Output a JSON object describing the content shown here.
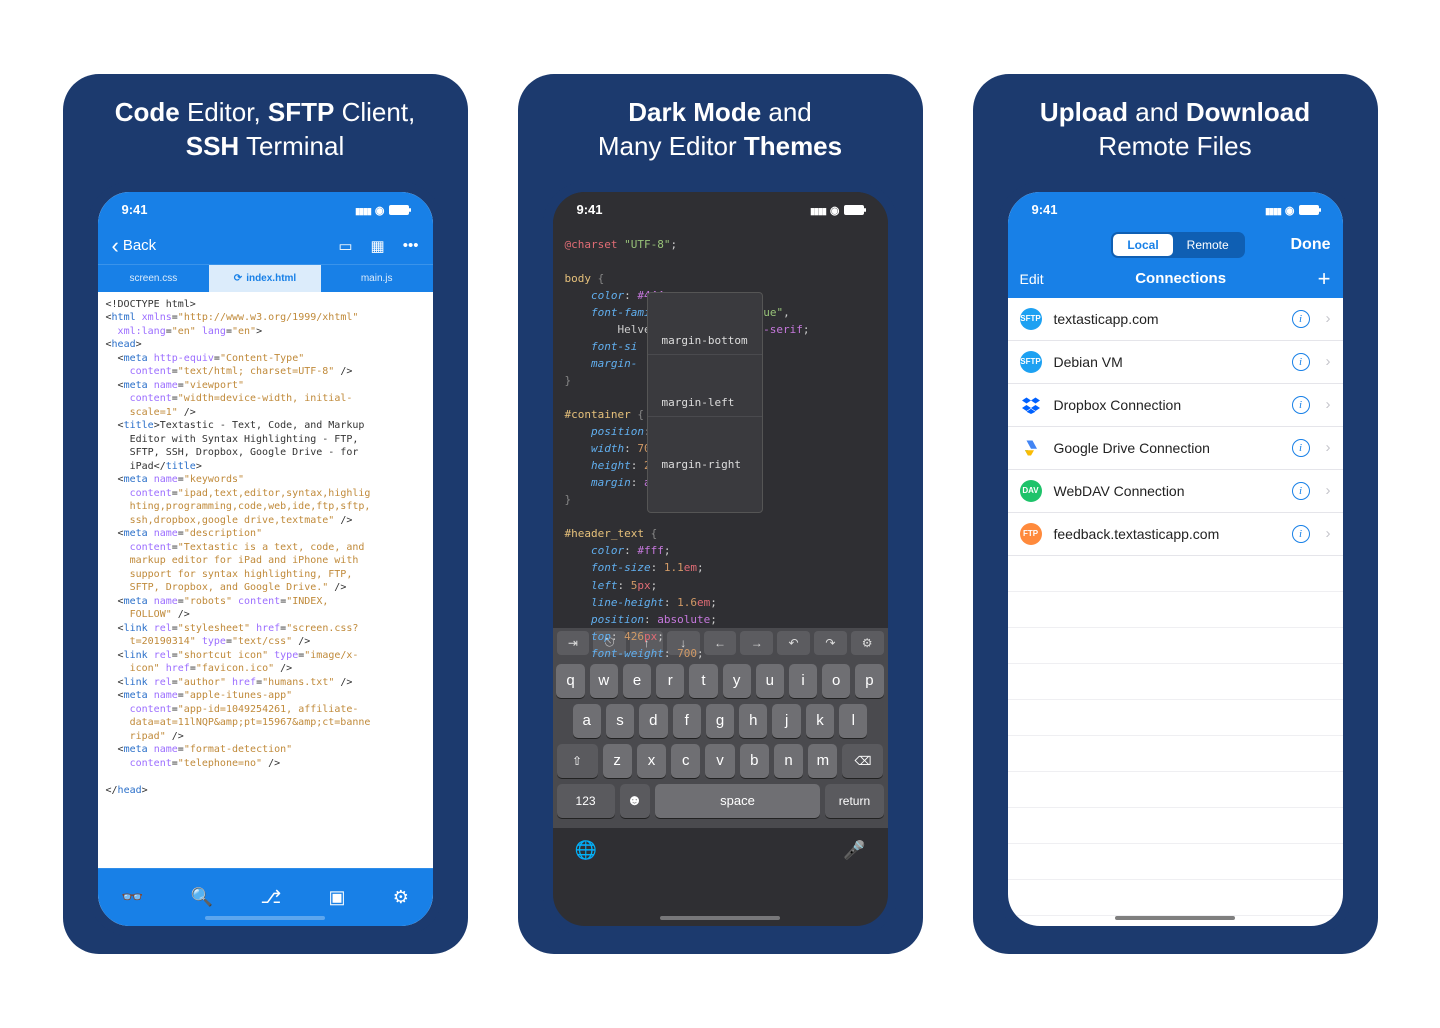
{
  "cards": {
    "s1_title_html": "<b>Code</b> Editor, <b>SFTP</b> Client,<br><b>SSH</b> Terminal",
    "s2_title_html": "<b>Dark Mode</b> and<br>Many Editor <b>Themes</b>",
    "s3_title_html": "<b>Upload</b> and <b>Download</b><br>Remote Files"
  },
  "status_time": "9:41",
  "s1": {
    "back": "Back",
    "tabs": [
      "screen.css",
      "index.html",
      "main.js"
    ],
    "active_tab": 1,
    "code_html": "&lt;!DOCTYPE html&gt;\n&lt;<b>html</b> <span class='a'>xmlns</span>=<span class='s'>\"http://www.w3.org/1999/xhtml\"</span>\n  <span class='a'>xml:lang</span>=<span class='s'>\"en\"</span> <span class='a'>lang</span>=<span class='s'>\"en\"</span>&gt;\n&lt;<b>head</b>&gt;\n  &lt;<b>meta</b> <span class='a'>http-equiv</span>=<span class='s'>\"Content-Type\"</span>\n    <span class='a'>content</span>=<span class='s'>\"text/html; charset=UTF-8\"</span> /&gt;\n  &lt;<b>meta</b> <span class='a'>name</span>=<span class='s'>\"viewport\"</span>\n    <span class='a'>content</span>=<span class='s'>\"width=device-width, initial-\n    scale=1\"</span> /&gt;\n  &lt;<b>title</b>&gt;Textastic - Text, Code, and Markup\n    Editor with Syntax Highlighting - FTP,\n    SFTP, SSH, Dropbox, Google Drive - for\n    iPad&lt;/<b>title</b>&gt;\n  &lt;<b>meta</b> <span class='a'>name</span>=<span class='s'>\"keywords\"</span>\n    <span class='a'>content</span>=<span class='s'>\"ipad,text,editor,syntax,highlig\n    hting,programming,code,web,ide,ftp,sftp,\n    ssh,dropbox,google drive,textmate\"</span> /&gt;\n  &lt;<b>meta</b> <span class='a'>name</span>=<span class='s'>\"description\"</span>\n    <span class='a'>content</span>=<span class='s'>\"Textastic is a text, code, and\n    markup editor for iPad and iPhone with\n    support for syntax highlighting, FTP,\n    SFTP, Dropbox, and Google Drive.\"</span> /&gt;\n  &lt;<b>meta</b> <span class='a'>name</span>=<span class='s'>\"robots\"</span> <span class='a'>content</span>=<span class='s'>\"INDEX,\n    FOLLOW\"</span> /&gt;\n  &lt;<b>link</b> <span class='a'>rel</span>=<span class='s'>\"stylesheet\"</span> <span class='a'>href</span>=<span class='s'>\"screen.css?\n    t=20190314\"</span> <span class='a'>type</span>=<span class='s'>\"text/css\"</span> /&gt;\n  &lt;<b>link</b> <span class='a'>rel</span>=<span class='s'>\"shortcut icon\"</span> <span class='a'>type</span>=<span class='s'>\"image/x-\n    icon\"</span> <span class='a'>href</span>=<span class='s'>\"favicon.ico\"</span> /&gt;\n  &lt;<b>link</b> <span class='a'>rel</span>=<span class='s'>\"author\"</span> <span class='a'>href</span>=<span class='s'>\"humans.txt\"</span> /&gt;\n  &lt;<b>meta</b> <span class='a'>name</span>=<span class='s'>\"apple-itunes-app\"</span>\n    <span class='a'>content</span>=<span class='s'>\"app-id=1049254261, affiliate-\n    data=at=11lNQP&amp;amp;pt=15967&amp;amp;ct=banne\n    ripad\"</span> /&gt;\n  &lt;<b>meta</b> <span class='a'>name</span>=<span class='s'>\"format-detection\"</span>\n    <span class='a'>content</span>=<span class='s'>\"telephone=no\"</span> /&gt;\n\n&lt;/<b>head</b>&gt;"
  },
  "s2": {
    "code_html": "<span class='tk-pp'>@charset</span> <span class='tk-str'>\"UTF-8\"</span>;\n\n<span class='tk-sel'>body</span> <span class='tk-br'>{</span>\n    <span class='tk-prop'>color</span>: <span class='tk-val'>#444</span>;\n    <span class='tk-prop'>font-family</span>: <span class='tk-str'>\"Helvetica Neue\"</span>,\n        Helvetica, Arial, <span class='tk-kw'>sans-serif</span>;\n    <span class='tk-prop'>font-si</span>\n    <span class='tk-prop'>margin-</span>\n<span class='tk-br'>}</span>\n\n<span class='tk-sel'>#container</span> <span class='tk-br'>{</span>\n    <span class='tk-prop'>position</span>: <span class='tk-kw'>relative</span>;\n    <span class='tk-prop'>width</span>: <span class='tk-num'>702</span><span class='tk-unit'>px</span>;\n    <span class='tk-prop'>height</span>: <span class='tk-num'>2100</span><span class='tk-unit'>px</span>;\n    <span class='tk-prop'>margin</span>: <span class='tk-kw'>auto</span>;\n<span class='tk-br'>}</span>\n\n<span class='tk-sel'>#header_text</span> <span class='tk-br'>{</span>\n    <span class='tk-prop'>color</span>: <span class='tk-val'>#fff</span>;\n    <span class='tk-prop'>font-size</span>: <span class='tk-num'>1.1</span><span class='tk-unit'>em</span>;\n    <span class='tk-prop'>left</span>: <span class='tk-num'>5</span><span class='tk-unit'>px</span>;\n    <span class='tk-prop'>line-height</span>: <span class='tk-num'>1.6</span><span class='tk-unit'>em</span>;\n    <span class='tk-prop'>position</span>: <span class='tk-kw'>absolute</span>;\n    <span class='tk-prop'>top</span>: <span class='tk-num'>426</span><span class='tk-unit'>px</span>;\n    <span class='tk-prop'>font-weight</span>: <span class='tk-num'>700</span>;",
    "autocomplete": [
      "margin-bottom",
      "margin-left",
      "margin-right"
    ],
    "accessory": [
      "⇥",
      "⎋",
      "↑",
      "↓",
      "←",
      "→",
      "↶",
      "↷",
      "⚙"
    ],
    "kb_row1": [
      "q",
      "w",
      "e",
      "r",
      "t",
      "y",
      "u",
      "i",
      "o",
      "p"
    ],
    "kb_row2": [
      "a",
      "s",
      "d",
      "f",
      "g",
      "h",
      "j",
      "k",
      "l"
    ],
    "kb_row3_shift": "⇧",
    "kb_row3": [
      "z",
      "x",
      "c",
      "v",
      "b",
      "n",
      "m"
    ],
    "kb_row3_del": "⌫",
    "kb_123": "123",
    "kb_emoji": "☻",
    "kb_space": "space",
    "kb_return": "return"
  },
  "s3": {
    "seg": [
      "Local",
      "Remote"
    ],
    "seg_active": 0,
    "done": "Done",
    "edit": "Edit",
    "title": "Connections",
    "connections": [
      {
        "badge": "b-sftp",
        "badge_text": "SFTP",
        "name": "textasticapp.com"
      },
      {
        "badge": "b-sftp",
        "badge_text": "SFTP",
        "name": "Debian VM"
      },
      {
        "badge": "b-dbx",
        "badge_text": "",
        "name": "Dropbox Connection"
      },
      {
        "badge": "b-gd",
        "badge_text": "",
        "name": "Google Drive Connection"
      },
      {
        "badge": "b-dav",
        "badge_text": "DAV",
        "name": "WebDAV Connection"
      },
      {
        "badge": "b-fdbk",
        "badge_text": "FTP",
        "name": "feedback.textasticapp.com"
      }
    ]
  }
}
